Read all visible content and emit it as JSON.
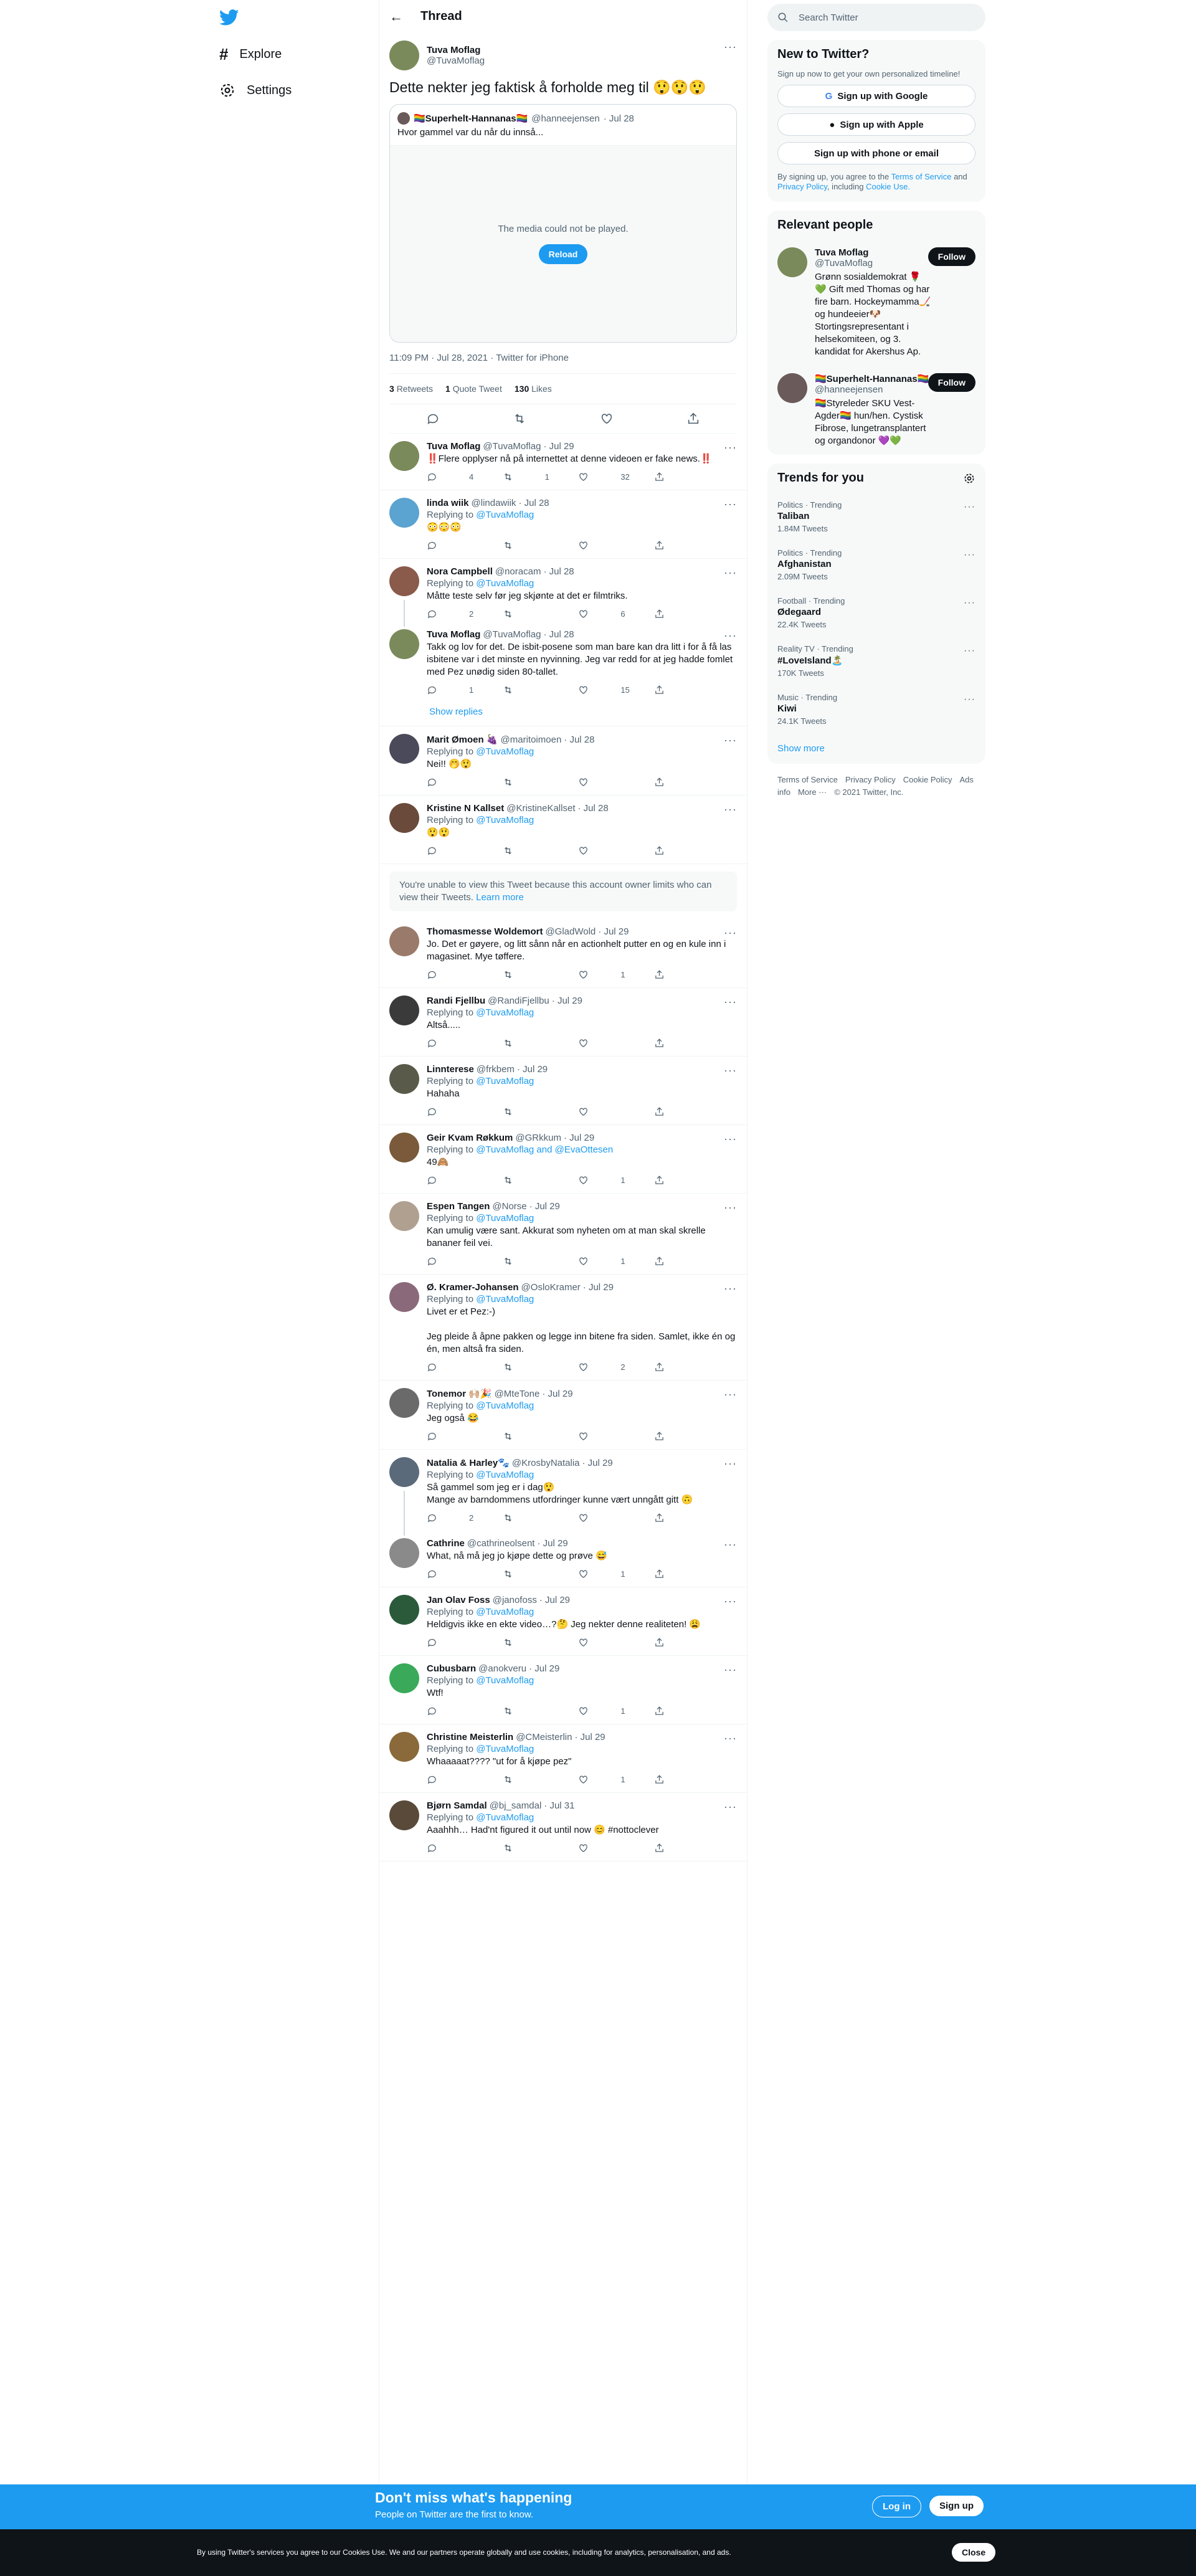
{
  "nav": {
    "explore": "Explore",
    "settings": "Settings"
  },
  "header": {
    "title": "Thread"
  },
  "main_tweet": {
    "name": "Tuva Moflag",
    "handle": "@TuvaMoflag",
    "text": "Dette nekter jeg faktisk å forholde meg til 😲😲😲",
    "quote": {
      "name": "🏳️‍🌈Superhelt-Hannanas🏳️‍🌈",
      "handle": "@hanneejensen",
      "date": "· Jul 28",
      "text": "Hvor gammel var du når du innså..."
    },
    "media_msg": "The media could not be played.",
    "reload": "Reload",
    "meta": "11:09 PM · Jul 28, 2021 · Twitter for iPhone",
    "retweets": "3",
    "retweets_label": "Retweets",
    "quotes": "1",
    "quotes_label": "Quote Tweet",
    "likes": "130",
    "likes_label": "Likes"
  },
  "replies": [
    {
      "name": "Tuva Moflag",
      "handle": "@TuvaMoflag",
      "date": "· Jul 29",
      "replying": "",
      "text": "‼️Flere opplyser nå på internettet at denne videoen er fake news.‼️",
      "reply": "4",
      "rt": "1",
      "like": "32",
      "av": "#7a8a5a"
    },
    {
      "name": "linda wiik",
      "handle": "@lindawiik",
      "date": "· Jul 28",
      "replying": "@TuvaMoflag",
      "text": "😳😳😳",
      "reply": "",
      "rt": "",
      "like": "",
      "av": "#5ba3d0"
    },
    {
      "name": "Nora Campbell",
      "handle": "@noracam",
      "date": "· Jul 28",
      "replying": "@TuvaMoflag",
      "text": "Måtte teste selv før jeg skjønte at det er filmtriks.",
      "reply": "2",
      "rt": "",
      "like": "6",
      "av": "#8a5a4a"
    },
    {
      "name": "Tuva Moflag",
      "handle": "@TuvaMoflag",
      "date": "· Jul 28",
      "replying": "",
      "text": "Takk og lov for det. De isbit-posene som man bare kan dra litt i for å få las isbitene var i det minste en nyvinning. Jeg var redd for at jeg hadde fomlet med Pez unødig siden 80-tallet.",
      "reply": "1",
      "rt": "",
      "like": "15",
      "av": "#7a8a5a"
    },
    {
      "name": "Marit Ømoen 🍇",
      "handle": "@maritoimoen",
      "date": "· Jul 28",
      "replying": "@TuvaMoflag",
      "text": "Nei!! 🤭😲",
      "reply": "",
      "rt": "",
      "like": "",
      "av": "#4a4a5a"
    },
    {
      "name": "Kristine N Kallset",
      "handle": "@KristineKallset",
      "date": "· Jul 28",
      "replying": "@TuvaMoflag",
      "text": "😲😲",
      "reply": "",
      "rt": "",
      "like": "",
      "av": "#6a4a3a"
    },
    {
      "name": "Thomasmesse Woldemort",
      "handle": "@GladWold",
      "date": "· Jul 29",
      "replying": "",
      "text": "Jo. Det er gøyere, og litt sånn når en actionhelt putter en og en kule inn i magasinet. Mye tøffere.",
      "reply": "",
      "rt": "",
      "like": "1",
      "av": "#9a7a6a"
    },
    {
      "name": "Randi Fjellbu",
      "handle": "@RandiFjellbu",
      "date": "· Jul 29",
      "replying": "@TuvaMoflag",
      "text": "Altså.....",
      "reply": "",
      "rt": "",
      "like": "",
      "av": "#3a3a3a"
    },
    {
      "name": "Linnterese",
      "handle": "@frkbem",
      "date": "· Jul 29",
      "replying": "@TuvaMoflag",
      "text": "Hahaha",
      "reply": "",
      "rt": "",
      "like": "",
      "av": "#5a5a4a"
    },
    {
      "name": "Geir Kvam Røkkum",
      "handle": "@GRkkum",
      "date": "· Jul 29",
      "replying": "@TuvaMoflag and @EvaOttesen",
      "text": "49🙈",
      "reply": "",
      "rt": "",
      "like": "1",
      "av": "#7a5a3a"
    },
    {
      "name": "Espen Tangen",
      "handle": "@Norse",
      "date": "· Jul 29",
      "replying": "@TuvaMoflag",
      "text": "Kan umulig være sant. Akkurat som nyheten om at man skal skrelle bananer feil vei.",
      "reply": "",
      "rt": "",
      "like": "1",
      "av": "#b0a090"
    },
    {
      "name": "Ø. Kramer-Johansen",
      "handle": "@OsloKramer",
      "date": "· Jul 29",
      "replying": "@TuvaMoflag",
      "text": "Livet er et Pez:-)\n\nJeg pleide å åpne pakken og legge inn bitene fra siden. Samlet, ikke én og én, men altså fra siden.",
      "reply": "",
      "rt": "",
      "like": "2",
      "av": "#8a6a7a"
    },
    {
      "name": "Tonemor 🙌🏼🎉",
      "handle": "@MteTone",
      "date": "· Jul 29",
      "replying": "@TuvaMoflag",
      "text": "Jeg også 😂",
      "reply": "",
      "rt": "",
      "like": "",
      "av": "#6a6a6a"
    },
    {
      "name": "Natalia & Harley🐾",
      "handle": "@KrosbyNatalia",
      "date": "· Jul 29",
      "replying": "@TuvaMoflag",
      "text": "Så gammel som jeg er i dag😲\nMange av barndommens utfordringer kunne vært unngått gitt 🙃",
      "reply": "2",
      "rt": "",
      "like": "",
      "av": "#5a6a7a"
    },
    {
      "name": "Cathrine",
      "handle": "@cathrineolsent",
      "date": "· Jul 29",
      "replying": "",
      "text": "What, nå må jeg jo kjøpe dette og prøve 😅",
      "reply": "",
      "rt": "",
      "like": "1",
      "av": "#8a8a8a"
    },
    {
      "name": "Jan Olav Foss",
      "handle": "@janofoss",
      "date": "· Jul 29",
      "replying": "@TuvaMoflag",
      "text": "Heldigvis ikke en ekte video…?🤔 Jeg nekter denne realiteten! 😩",
      "reply": "",
      "rt": "",
      "like": "",
      "av": "#2a5a3a"
    },
    {
      "name": "Cubusbarn",
      "handle": "@anokveru",
      "date": "· Jul 29",
      "replying": "@TuvaMoflag",
      "text": "Wtf!",
      "reply": "",
      "rt": "",
      "like": "1",
      "av": "#3aaa5a"
    },
    {
      "name": "Christine Meisterlin",
      "handle": "@CMeisterlin",
      "date": "· Jul 29",
      "replying": "@TuvaMoflag",
      "text": "Whaaaaat???? \"ut for å kjøpe pez\"",
      "reply": "",
      "rt": "",
      "like": "1",
      "av": "#8a6a3a"
    },
    {
      "name": "Bjørn Samdal",
      "handle": "@bj_samdal",
      "date": "· Jul 31",
      "replying": "@TuvaMoflag",
      "text": "Aaahhh… Had'nt figured it out until now 😊 #nottoclever",
      "reply": "",
      "rt": "",
      "like": "",
      "av": "#5a4a3a"
    }
  ],
  "common": {
    "replying_label": "Replying to",
    "show_replies": "Show replies",
    "notice": "You're unable to view this Tweet because this account owner limits who can view their Tweets.",
    "learn_more": "Learn more"
  },
  "right": {
    "search": "Search Twitter",
    "new_title": "New to Twitter?",
    "new_sub": "Sign up now to get your own personalized timeline!",
    "google": "Sign up with Google",
    "apple": "Sign up with Apple",
    "phone": "Sign up with phone or email",
    "terms1": "By signing up, you agree to the",
    "terms_tos": "Terms of Service",
    "terms_and": "and",
    "terms_pp": "Privacy Policy",
    "terms_incl": ", including",
    "terms_cookie": "Cookie Use.",
    "relevant_title": "Relevant people",
    "follow": "Follow",
    "people": [
      {
        "name": "Tuva Moflag",
        "handle": "@TuvaMoflag",
        "bio": "Grønn sosialdemokrat 🌹💚 Gift med Thomas og har fire barn. Hockeymamma🏒 og hundeeier🐶 Stortingsrepresentant i helsekomiteen, og 3. kandidat for Akershus Ap."
      },
      {
        "name": "🏳️‍🌈Superhelt-Hannanas🏳️‍🌈",
        "handle": "@hanneejensen",
        "bio": "🏳️‍🌈Styreleder SKU Vest-Agder🏳️‍🌈 hun/hen. Cystisk Fibrose, lungetransplantert og organdonor 💜💚"
      }
    ],
    "trends_title": "Trends for you",
    "trends": [
      {
        "cat": "Politics · Trending",
        "name": "Taliban",
        "count": "1.84M Tweets"
      },
      {
        "cat": "Politics · Trending",
        "name": "Afghanistan",
        "count": "2.09M Tweets"
      },
      {
        "cat": "Football · Trending",
        "name": "Ødegaard",
        "count": "22.4K Tweets"
      },
      {
        "cat": "Reality TV · Trending",
        "name": "#LoveIsland🏝️",
        "count": "170K Tweets"
      },
      {
        "cat": "Music · Trending",
        "name": "Kiwi",
        "count": "24.1K Tweets"
      }
    ],
    "show_more": "Show more",
    "footer": [
      "Terms of Service",
      "Privacy Policy",
      "Cookie Policy",
      "Ads info",
      "More ···",
      "© 2021 Twitter, Inc."
    ]
  },
  "bottom": {
    "title": "Don't miss what's happening",
    "sub": "People on Twitter are the first to know.",
    "login": "Log in",
    "signup": "Sign up"
  },
  "cookie": {
    "text": "By using Twitter's services you agree to our Cookies Use. We and our partners operate globally and use cookies, including for analytics, personalisation, and ads.",
    "close": "Close"
  },
  "colors": {
    "accent": "#1d9bf0",
    "text": "#0f1419",
    "muted": "#536471"
  }
}
